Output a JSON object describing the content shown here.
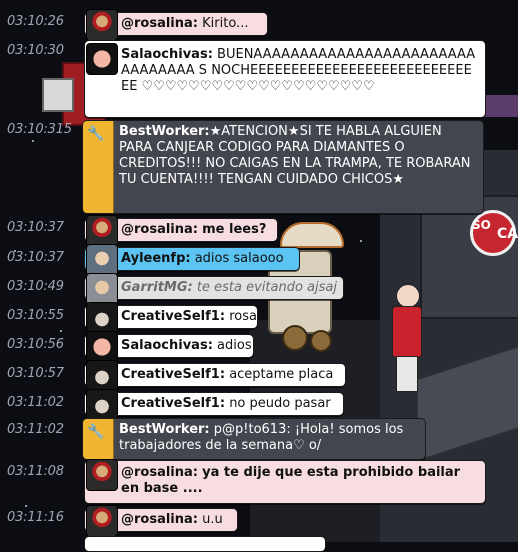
{
  "chat": [
    {
      "time": "03:10:26",
      "user": "@rosalina:",
      "text": "Kirito..."
    },
    {
      "time": "03:10:30",
      "user": "Salaochivas:",
      "text": "BUENAAAAAAAAAAAAAAAAAAAAAAAAAAAAAAAA S NOCHEEEEEEEEEEEEEEEEEEEEEEEEEEEEE ♡♡♡♡♡♡♡♡♡♡♡♡♡♡♡♡♡♡♡♡"
    },
    {
      "time": "03:10:315",
      "user": "BestWorker:",
      "text": "★ATENCION★SI TE HABLA ALGUIEN PARA CANJEAR CODIGO PARA DIAMANTES O CREDITOS!!! NO CAIGAS EN LA TRAMPA, TE ROBARAN TU CUENTA!!!! TENGAN CUIDADO CHICOS★"
    },
    {
      "time": "03:10:37",
      "user": "@rosalina:",
      "text": "me lees?"
    },
    {
      "time": "03:10:37",
      "user": "Ayleenfp:",
      "text": "adios salaooo"
    },
    {
      "time": "03:10:49",
      "user": "GarritMG:",
      "text": "te esta evitando ajsaj"
    },
    {
      "time": "03:10:55",
      "user": "CreativeSelf1:",
      "text": "rosa"
    },
    {
      "time": "03:10:56",
      "user": "Salaochivas:",
      "text": "adios"
    },
    {
      "time": "03:10:57",
      "user": "CreativeSelf1:",
      "text": "aceptame placa"
    },
    {
      "time": "03:11:02",
      "user": "CreativeSelf1:",
      "text": "no peudo pasar"
    },
    {
      "time": "03:11:02",
      "user": "BestWorker:",
      "text": "p@p!to613: ¡Hola! somos los trabajadores de la semana♡ o/"
    },
    {
      "time": "03:11:08",
      "user": "@rosalina:",
      "text": "ya te dije que esta prohibido bailar en base ...."
    },
    {
      "time": "03:11:16",
      "user": "@rosalina:",
      "text": "u.u"
    }
  ],
  "scene": {
    "sign_text_1": "SO",
    "sign_text_2": "CA"
  },
  "colors": {
    "pink": "#f7dce1",
    "white": "#ffffff",
    "blue": "#5cc4f2",
    "gray": "#e2e2e2",
    "dark": "#44464f",
    "bot": "#f2b531"
  }
}
